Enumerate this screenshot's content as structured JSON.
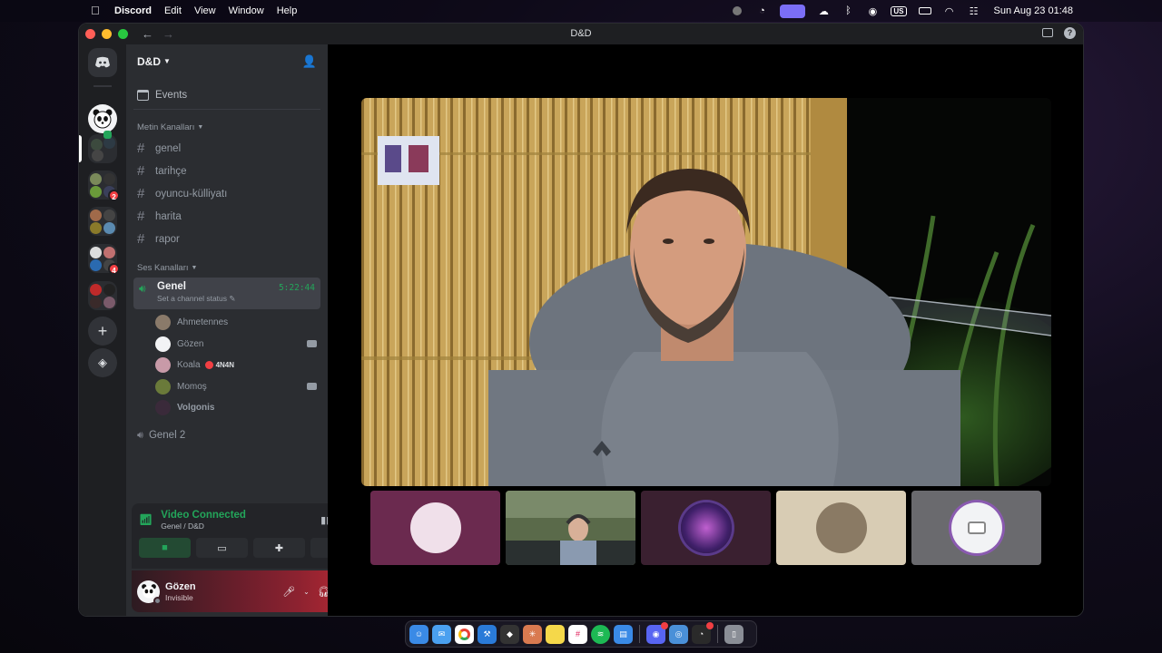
{
  "menubar": {
    "app_name": "Discord",
    "items": [
      "Edit",
      "View",
      "Window",
      "Help"
    ],
    "keyboard_layout": "US",
    "datetime": "Sun Aug 23  01:48"
  },
  "window": {
    "title": "D&D"
  },
  "server_rail": {
    "badges": [
      "2",
      "4"
    ]
  },
  "guild": {
    "name": "D&D",
    "events_label": "Events",
    "text_category": "Metin Kanalları",
    "text_channels": [
      "genel",
      "tarihçe",
      "oyuncu-külliyatı",
      "harita",
      "rapor"
    ],
    "voice_category": "Ses Kanalları",
    "active_voice": {
      "name": "Genel",
      "timer": "5:22:44",
      "status_placeholder": "Set a channel status"
    },
    "voice_users": [
      {
        "name": "Ahmetennes",
        "camera": false
      },
      {
        "name": "Gözen",
        "camera": true
      },
      {
        "name": "Koala",
        "camera": false,
        "tag": "4N4N"
      },
      {
        "name": "Momoş",
        "camera": true
      },
      {
        "name": "Volgonis",
        "camera": false
      }
    ],
    "other_voice": "Genel 2"
  },
  "rtc": {
    "status": "Video Connected",
    "location": "Genel / D&D"
  },
  "user_panel": {
    "name": "Gözen",
    "status": "Invisible"
  },
  "colors": {
    "accent_green": "#23a55a",
    "danger_red": "#f23f43",
    "sidebar": "#2b2d31",
    "rail": "#1e1f22"
  },
  "icons": {
    "menubar": [
      "apple-icon",
      "record-icon",
      "stats-icon",
      "screen-icon",
      "cloud-icon",
      "bluetooth-icon",
      "gamepad-icon",
      "battery-icon",
      "wifi-icon",
      "control-center-icon"
    ],
    "dock": [
      "finder-icon",
      "mail-icon",
      "chrome-icon",
      "xcode-icon",
      "cube-icon",
      "claude-icon",
      "notes-icon",
      "slack-icon",
      "spotify-icon",
      "files-icon",
      "discord-icon",
      "app-store-icon",
      "activity-icon",
      "trash-icon"
    ]
  }
}
